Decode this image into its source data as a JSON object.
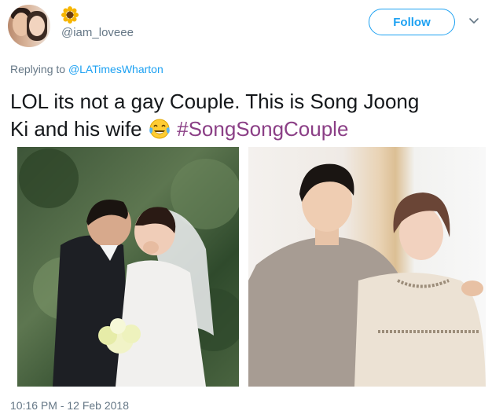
{
  "user": {
    "handle": "@iam_loveee",
    "avatar": "profile-photo-couple"
  },
  "follow_button": {
    "label": "Follow"
  },
  "reply": {
    "prefix": "Replying to",
    "mention": "@LATimesWharton"
  },
  "tweet": {
    "text_line1": "LOL its not a gay Couple. This is Song Joong",
    "text_line2": "Ki and his wife",
    "emoji": "face-with-tears-of-joy",
    "hashtag": "#SongSongCouple"
  },
  "media": [
    {
      "name": "wedding-kiss-photo"
    },
    {
      "name": "couple-portrait-photo"
    }
  ],
  "timestamp": "10:16 PM - 12 Feb 2018",
  "colors": {
    "link": "#1da1f2",
    "hashtag": "#8b3f86",
    "secondary_text": "#657786"
  }
}
